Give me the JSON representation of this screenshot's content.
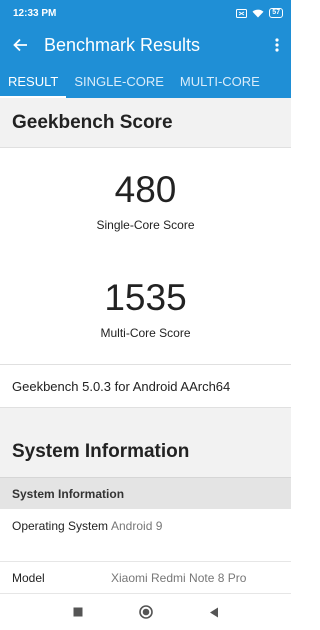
{
  "status_bar": {
    "time": "12:33 PM",
    "battery": "57",
    "icons": [
      "screen-icon",
      "wifi-icon",
      "battery-icon"
    ]
  },
  "app_bar": {
    "title": "Benchmark Results",
    "icons": [
      "back-arrow-icon",
      "more-vertical-icon"
    ]
  },
  "tabs": [
    {
      "label": "RESULT",
      "active": true
    },
    {
      "label": "SINGLE-CORE",
      "active": false
    },
    {
      "label": "MULTI-CORE",
      "active": false
    }
  ],
  "geekbench": {
    "heading": "Geekbench Score",
    "single_core": {
      "value": "480",
      "label": "Single-Core Score"
    },
    "multi_core": {
      "value": "1535",
      "label": "Multi-Core Score"
    },
    "version": "Geekbench 5.0.3 for Android AArch64"
  },
  "system_info": {
    "heading": "System Information",
    "subheading": "System Information",
    "rows": [
      {
        "key": "Operating System",
        "value": "Android 9"
      },
      {
        "key": "Model",
        "value": "Xiaomi Redmi Note 8 Pro"
      }
    ]
  },
  "nav_bar": {
    "icons": [
      "recents-square-icon",
      "home-circle-icon",
      "back-triangle-icon"
    ]
  },
  "colors": {
    "primary": "#1f8fd6",
    "section_bg": "#f2f2f2",
    "subhead_bg": "#e4e4e4"
  }
}
